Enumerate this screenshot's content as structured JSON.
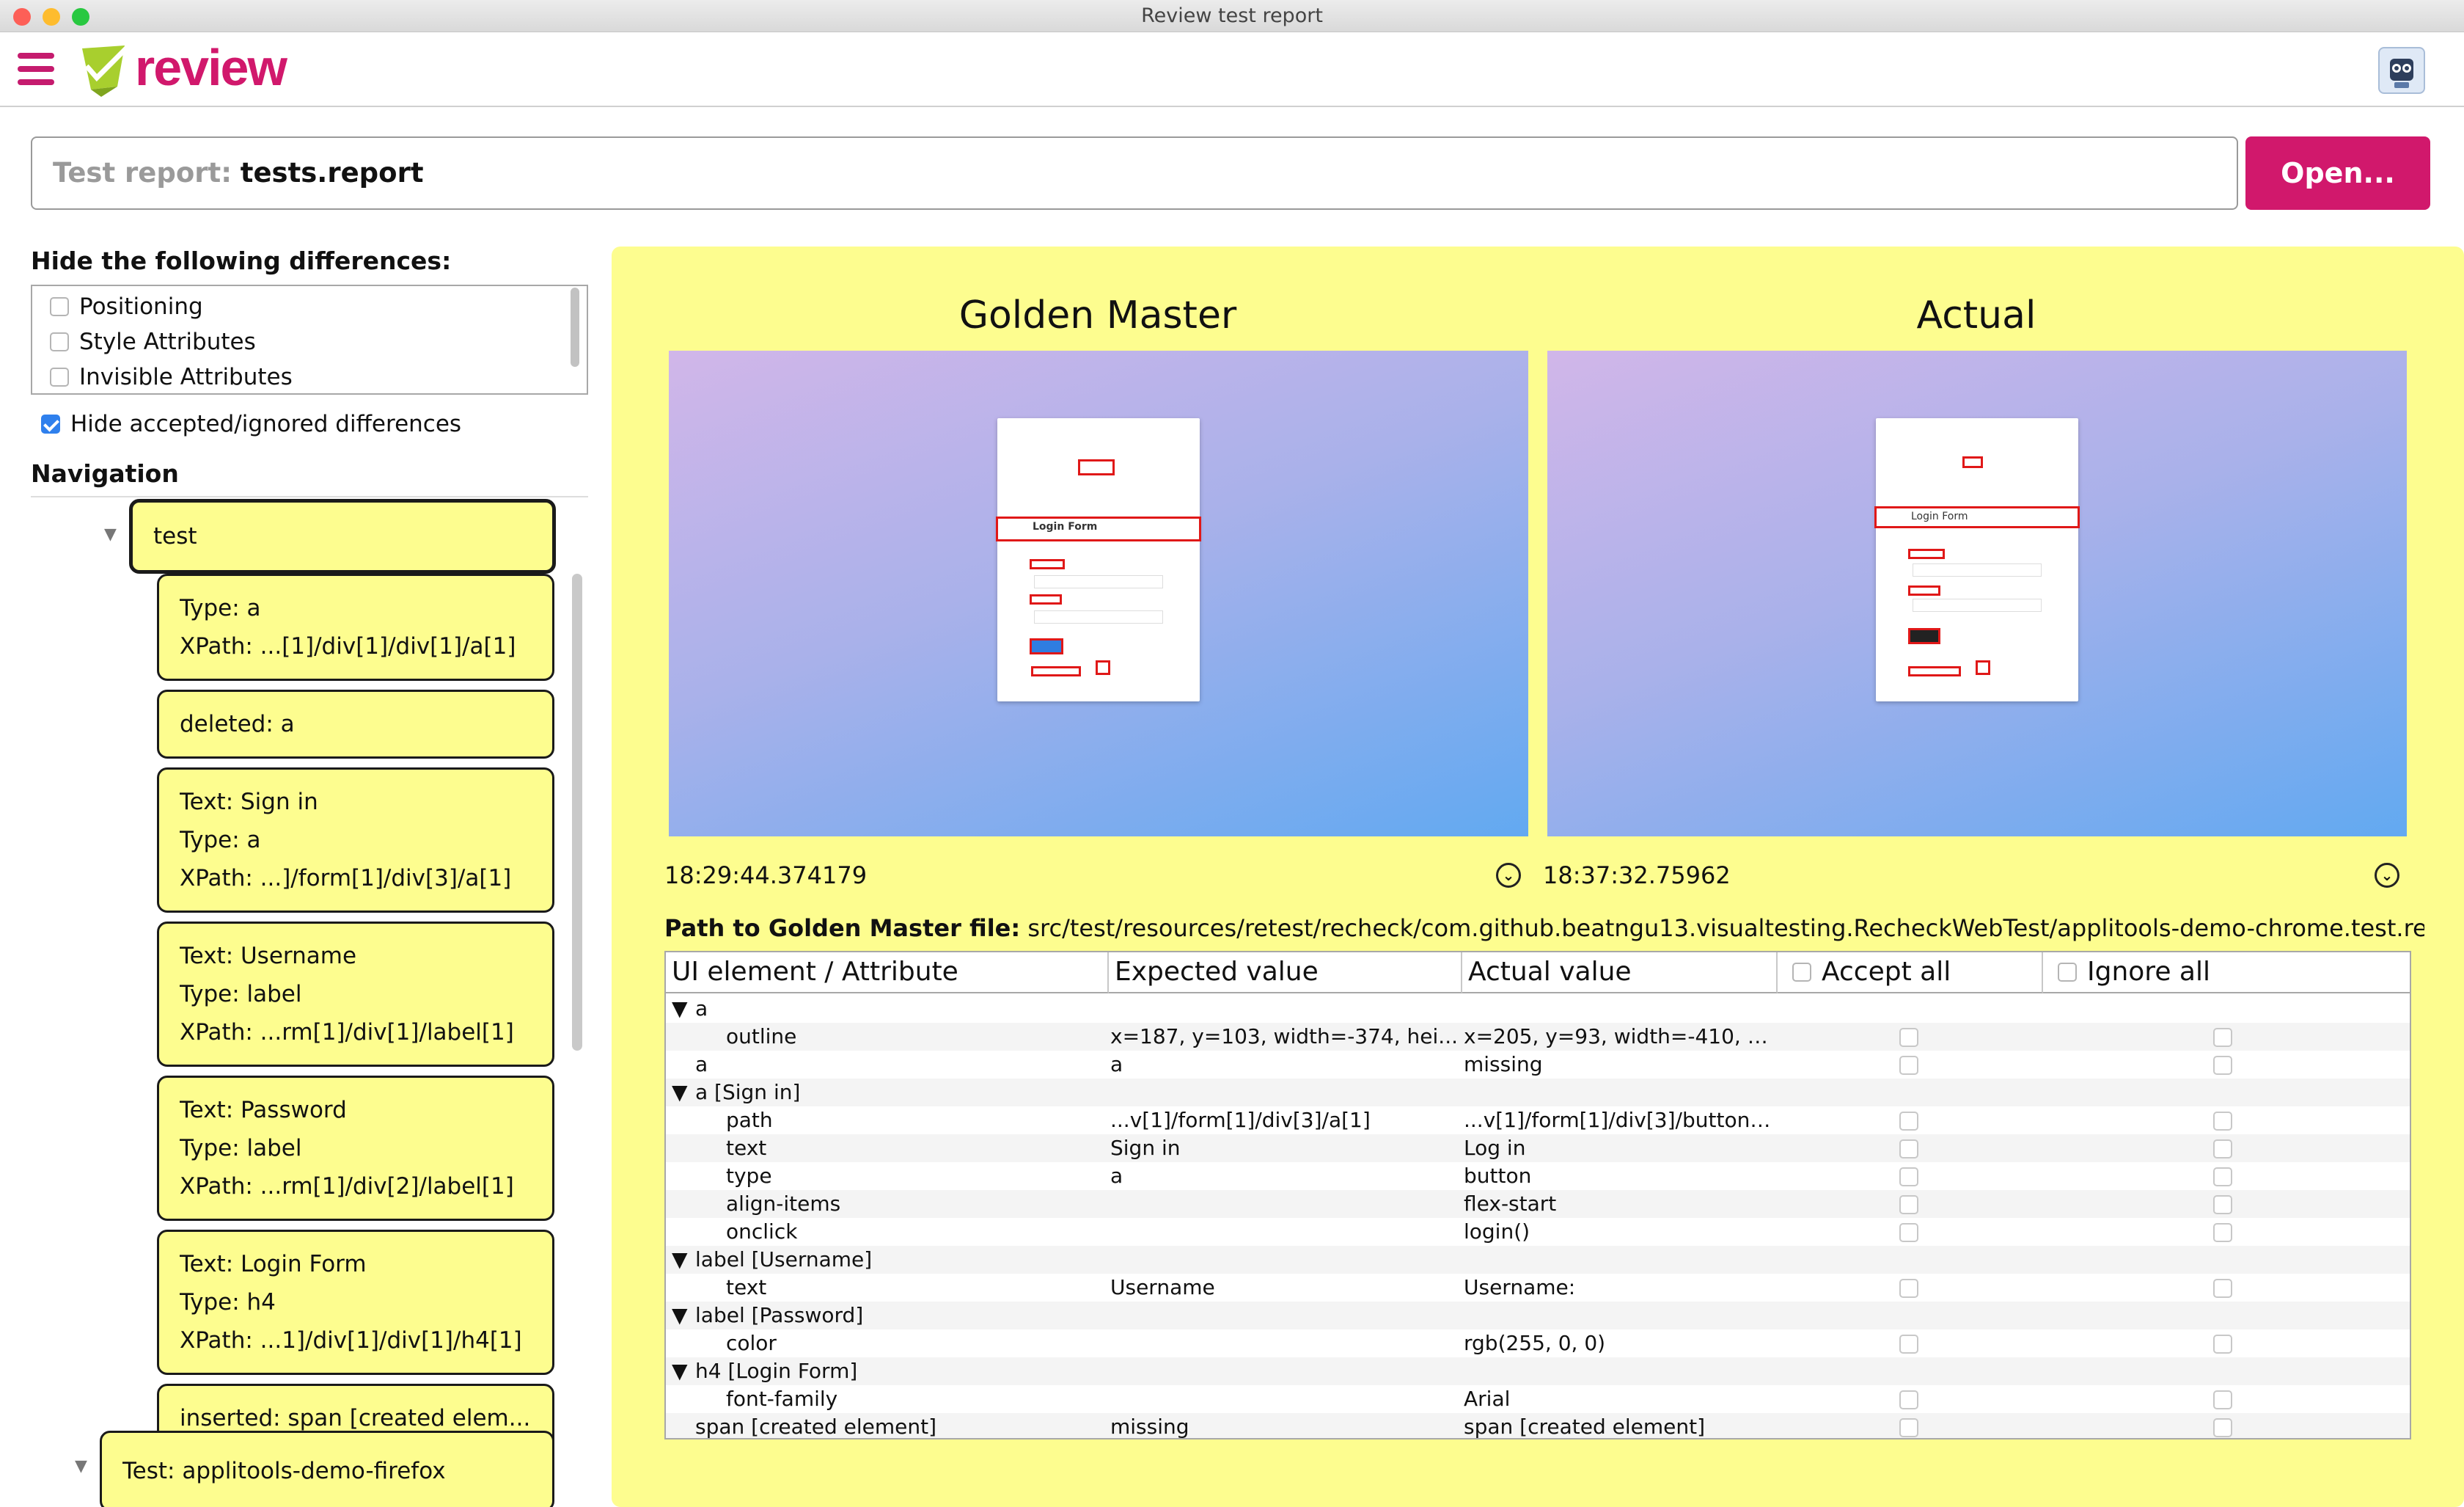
{
  "window": {
    "title": "Review test report"
  },
  "app": {
    "logo_text": "review"
  },
  "report": {
    "label": "Test report:",
    "value": "tests.report",
    "open_button": "Open..."
  },
  "filters": {
    "heading": "Hide the following differences:",
    "items": [
      {
        "label": "Positioning",
        "checked": false
      },
      {
        "label": "Style Attributes",
        "checked": false
      },
      {
        "label": "Invisible Attributes",
        "checked": false
      }
    ],
    "hide_accepted_label": "Hide accepted/ignored differences",
    "hide_accepted_checked": true
  },
  "navigation": {
    "heading": "Navigation",
    "root": "test",
    "items": [
      {
        "lines": [
          "Type:  a",
          "XPath: ...[1]/div[1]/div[1]/a[1]"
        ]
      },
      {
        "lines": [
          "deleted: a"
        ]
      },
      {
        "lines": [
          "Text:  Sign in",
          "Type:  a",
          "XPath: ...]/form[1]/div[3]/a[1]"
        ]
      },
      {
        "lines": [
          "Text:  Username",
          "Type:  label",
          "XPath: ...rm[1]/div[1]/label[1]"
        ]
      },
      {
        "lines": [
          "Text:  Password",
          "Type:  label",
          "XPath: ...rm[1]/div[2]/label[1]"
        ]
      },
      {
        "lines": [
          "Text:  Login Form",
          "Type:  h4",
          "XPath: ...1]/div[1]/div[1]/h4[1]"
        ]
      },
      {
        "lines": [
          "inserted: span [created elem..."
        ]
      }
    ],
    "next_test": "Test: applitools-demo-firefox"
  },
  "comparison": {
    "golden_title": "Golden Master",
    "actual_title": "Actual",
    "golden_time": "18:29:44.374179",
    "actual_time": "18:37:32.75962",
    "form_title": "Login Form",
    "path_label": "Path to Golden Master file:",
    "path_value": "src/test/resources/retest/recheck/com.github.beatngu13.visualtesting.RecheckWebTest/applitools-demo-chrome.test.re..."
  },
  "table": {
    "headers": [
      "UI element / Attribute",
      "Expected value",
      "Actual value",
      "Accept all",
      "Ignore all"
    ],
    "rows": [
      {
        "toggle": "▼",
        "element": "a",
        "expected": "",
        "actual": "",
        "indent": false,
        "check": false
      },
      {
        "toggle": "",
        "element": "outline",
        "expected": "x=187, y=103, width=-374, hei...",
        "actual": "x=205, y=93, width=-410, h...",
        "indent": true,
        "check": true
      },
      {
        "toggle": "",
        "element": "a",
        "expected": "a",
        "actual": "missing",
        "indent": false,
        "check": true
      },
      {
        "toggle": "▼",
        "element": "a [Sign in]",
        "expected": "",
        "actual": "",
        "indent": false,
        "check": false
      },
      {
        "toggle": "",
        "element": "path",
        "expected": "...v[1]/form[1]/div[3]/a[1]",
        "actual": "...v[1]/form[1]/div[3]/button[...",
        "indent": true,
        "check": true
      },
      {
        "toggle": "",
        "element": "text",
        "expected": "Sign in",
        "actual": "Log in",
        "indent": true,
        "check": true
      },
      {
        "toggle": "",
        "element": "type",
        "expected": "a",
        "actual": "button",
        "indent": true,
        "check": true
      },
      {
        "toggle": "",
        "element": "align-items",
        "expected": "",
        "actual": "flex-start",
        "indent": true,
        "check": true
      },
      {
        "toggle": "",
        "element": "onclick",
        "expected": "",
        "actual": "login()",
        "indent": true,
        "check": true
      },
      {
        "toggle": "▼",
        "element": "label [Username]",
        "expected": "",
        "actual": "",
        "indent": false,
        "check": false
      },
      {
        "toggle": "",
        "element": "text",
        "expected": "Username",
        "actual": "Username:",
        "indent": true,
        "check": true
      },
      {
        "toggle": "▼",
        "element": "label [Password]",
        "expected": "",
        "actual": "",
        "indent": false,
        "check": false
      },
      {
        "toggle": "",
        "element": "color",
        "expected": "",
        "actual": "rgb(255, 0, 0)",
        "indent": true,
        "check": true
      },
      {
        "toggle": "▼",
        "element": "h4 [Login Form]",
        "expected": "",
        "actual": "",
        "indent": false,
        "check": false
      },
      {
        "toggle": "",
        "element": "font-family",
        "expected": "",
        "actual": "Arial",
        "indent": true,
        "check": true
      },
      {
        "toggle": "",
        "element": "span [created element]",
        "expected": "missing",
        "actual": "span [created element]",
        "indent": false,
        "check": true
      }
    ]
  },
  "colors": {
    "accent": "#d1186c",
    "panel": "#fdfd8f",
    "logo_green": "#a8cf2e",
    "highlight": "#e01818"
  }
}
